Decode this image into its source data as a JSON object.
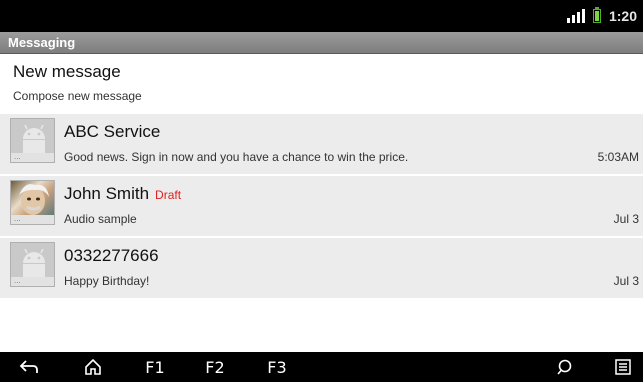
{
  "status_bar": {
    "time": "1:20",
    "signal_icon": "signal-icon",
    "battery_icon": "battery-icon",
    "battery_color": "#7fd63c"
  },
  "app": {
    "title": "Messaging"
  },
  "new_message": {
    "title": "New message",
    "subtitle": "Compose new message"
  },
  "threads": [
    {
      "name": "ABC  Service",
      "draft": "",
      "snippet": "Good news. Sign in now and you have a chance to win the price.",
      "time": "5:03AM",
      "avatar": "default-contact-icon"
    },
    {
      "name": "John Smith",
      "draft": "Draft",
      "snippet": "Audio sample",
      "time": "Jul 3",
      "avatar": "contact-photo"
    },
    {
      "name": "0332277666",
      "draft": "",
      "snippet": "Happy Birthday!",
      "time": "Jul 3",
      "avatar": "default-contact-icon"
    }
  ],
  "nav": {
    "back_icon": "back-icon",
    "home_icon": "home-icon",
    "f1": "F1",
    "f2": "F2",
    "f3": "F3",
    "search_icon": "search-icon",
    "menu_icon": "menu-icon"
  },
  "colors": {
    "draft": "#e02020",
    "title_bar": "#8a8a8a",
    "row_bg": "#ececec"
  }
}
